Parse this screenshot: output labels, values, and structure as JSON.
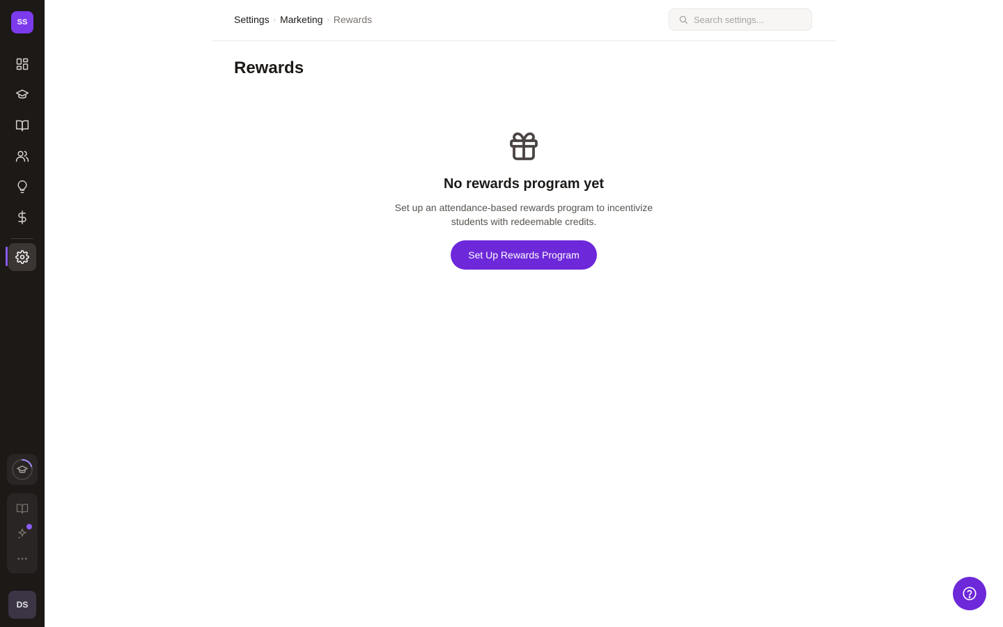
{
  "workspace": {
    "initials": "SS"
  },
  "sidebar": {
    "nav": [
      {
        "icon": "dashboard-icon"
      },
      {
        "icon": "graduation-cap-icon"
      },
      {
        "icon": "book-icon"
      },
      {
        "icon": "users-icon"
      },
      {
        "icon": "lightbulb-icon"
      },
      {
        "icon": "dollar-icon"
      },
      {
        "icon": "gear-icon",
        "active": true
      }
    ],
    "tools": [
      {
        "icon": "book-open-icon"
      },
      {
        "icon": "sparkle-icon",
        "has_notification": true
      },
      {
        "icon": "more-icon"
      }
    ],
    "user": {
      "initials": "DS"
    }
  },
  "breadcrumb": [
    "Settings",
    "Marketing",
    "Rewards"
  ],
  "search": {
    "placeholder": "Search settings..."
  },
  "page": {
    "title": "Rewards"
  },
  "empty_state": {
    "icon": "gift-icon",
    "title": "No rewards program yet",
    "description": "Set up an attendance-based rewards program to incentivize students with redeemable credits.",
    "button_label": "Set Up Rewards Program"
  },
  "help": {
    "icon": "help-icon"
  },
  "colors": {
    "accent": "#6d28d9",
    "sidebar_bg": "#1c1917",
    "active_indicator": "#8b5cf6"
  }
}
